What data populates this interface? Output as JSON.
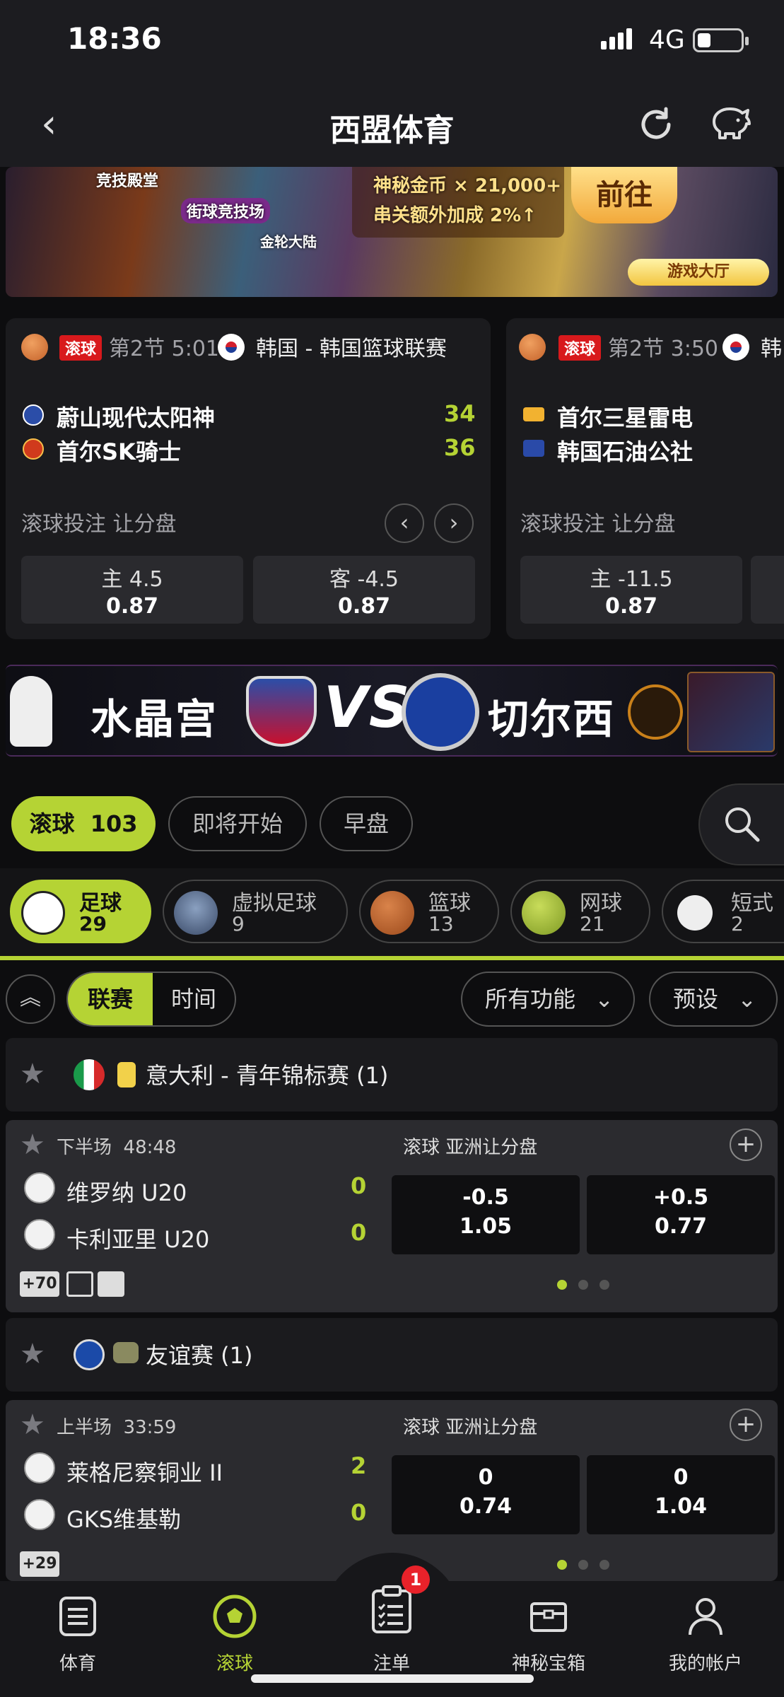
{
  "status_bar": {
    "time": "18:36",
    "network": "4G"
  },
  "header": {
    "title": "西盟体育"
  },
  "top_banner": {
    "labels": [
      "竞技殿堂",
      "街球竞技场",
      "金轮大陆"
    ],
    "reward_line1": "神秘金币 × 21,000+",
    "reward_line2": "串关额外加成 2%↑",
    "cta": "前往",
    "tag": "游戏大厅"
  },
  "live_cards": [
    {
      "badge": "滚球",
      "period": "第2节 5:01",
      "league": "韩国 - 韩国篮球联赛",
      "home": "蔚山现代太阳神",
      "home_score": "34",
      "away": "首尔SK骑士",
      "away_score": "36",
      "market": "滚球投注 让分盘",
      "odds": [
        {
          "label": "主  4.5",
          "price": "0.87"
        },
        {
          "label": "客  -4.5",
          "price": "0.87"
        }
      ]
    },
    {
      "badge": "滚球",
      "period": "第2节 3:50",
      "league": "韩",
      "home": "首尔三星雷电",
      "away": "韩国石油公社",
      "market": "滚球投注 让分盘",
      "odds": [
        {
          "label": "主  -11.5",
          "price": "0.87"
        }
      ]
    }
  ],
  "promo_banner": {
    "team_a": "水晶宫",
    "vs": "VS",
    "team_b": "切尔西"
  },
  "filters": {
    "live_label": "滚球",
    "live_count": "103",
    "upcoming": "即将开始",
    "early": "早盘"
  },
  "sports": [
    {
      "name": "足球",
      "count": "29"
    },
    {
      "name": "虚拟足球",
      "count": "9"
    },
    {
      "name": "篮球",
      "count": "13"
    },
    {
      "name": "网球",
      "count": "21"
    },
    {
      "name": "短式",
      "count": "2"
    }
  ],
  "view_toggle": {
    "league": "联赛",
    "time": "时间"
  },
  "dropdowns": {
    "features": "所有功能",
    "preset": "预设"
  },
  "leagues": [
    {
      "name": "意大利 - 青年锦标赛 (1)",
      "match": {
        "phase": "下半场",
        "clock": "48:48",
        "market": "滚球 亚洲让分盘",
        "home": "维罗纳 U20",
        "home_score": "0",
        "away": "卡利亚里 U20",
        "away_score": "0",
        "odds": [
          {
            "line": "-0.5",
            "price": "1.05"
          },
          {
            "line": "+0.5",
            "price": "0.77"
          }
        ],
        "more": "+70"
      }
    },
    {
      "name": "友谊赛 (1)",
      "match": {
        "phase": "上半场",
        "clock": "33:59",
        "market": "滚球 亚洲让分盘",
        "home": "莱格尼察铜业 II",
        "home_score": "2",
        "away": "GKS维基勒",
        "away_score": "0",
        "odds": [
          {
            "line": "0",
            "price": "0.74"
          },
          {
            "line": "0",
            "price": "1.04"
          }
        ],
        "more": "+29"
      }
    }
  ],
  "bottom_nav": {
    "items": [
      "体育",
      "滚球",
      "注单",
      "神秘宝箱",
      "我的帐户"
    ],
    "badge": "1"
  },
  "colors": {
    "accent": "#b5d334",
    "live_badge": "#d8191c",
    "background": "#0d0d0f"
  }
}
